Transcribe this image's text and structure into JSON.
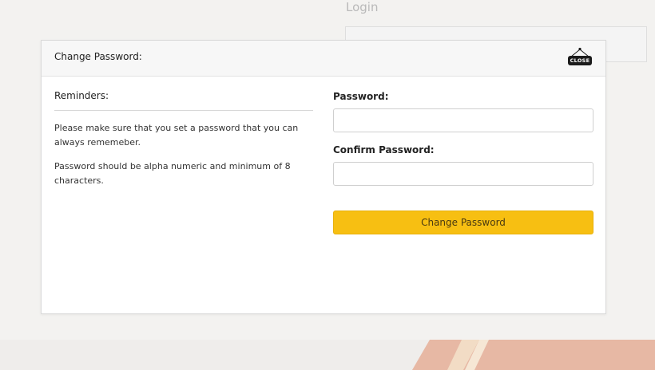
{
  "background": {
    "login_title": "Login"
  },
  "modal": {
    "title": "Change Password:",
    "close_label": "CLOSE"
  },
  "reminders": {
    "title": "Reminders:",
    "items": [
      "Please make sure that you set a password that you can always rememeber.",
      "Password should be alpha numeric and minimum of 8 characters."
    ]
  },
  "form": {
    "password_label": "Password:",
    "password_value": "",
    "confirm_label": "Confirm Password:",
    "confirm_value": "",
    "submit_label": "Change Password"
  },
  "colors": {
    "accent": "#f7bf12",
    "page_background": "#f3f2f0",
    "stripe_peach": "#e6b7a3",
    "stripe_cream": "#f1dcc5"
  }
}
